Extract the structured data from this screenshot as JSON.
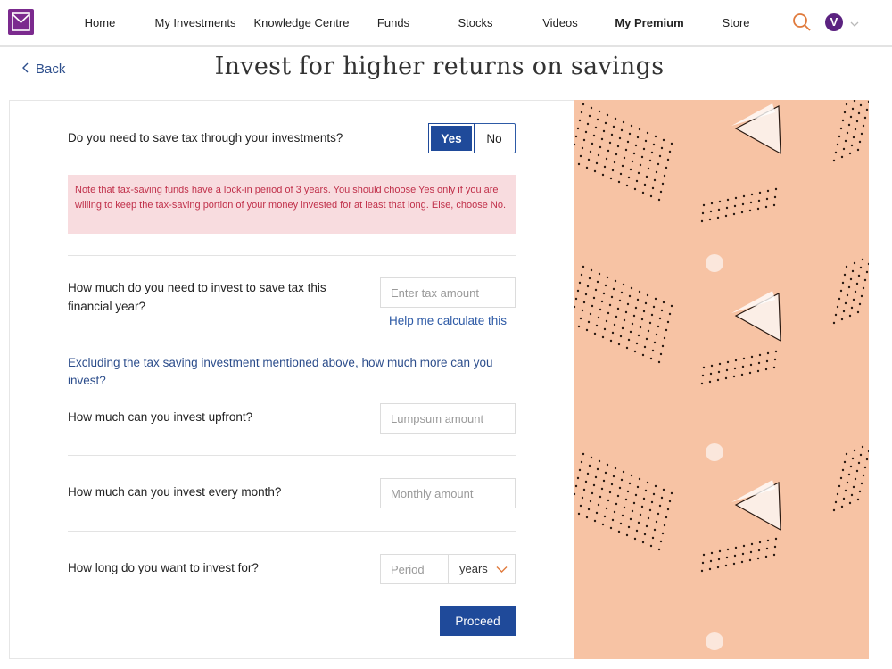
{
  "nav": {
    "items": [
      {
        "label": "Home",
        "bold": false
      },
      {
        "label": "My Investments",
        "bold": false
      },
      {
        "label": "Knowledge Centre",
        "bold": false
      },
      {
        "label": "Funds",
        "bold": false
      },
      {
        "label": "Stocks",
        "bold": false
      },
      {
        "label": "Videos",
        "bold": false
      },
      {
        "label": "My Premium",
        "bold": true
      },
      {
        "label": "Store",
        "bold": false
      }
    ],
    "avatar_letter": "V",
    "brand_color": "#7b2a8e",
    "search_icon_color": "#e07a3c"
  },
  "header": {
    "back_label": "Back",
    "title": "Invest for higher returns on savings"
  },
  "form": {
    "tax_question": "Do you need to save tax through your investments?",
    "toggle": {
      "yes_label": "Yes",
      "no_label": "No",
      "selected": "Yes"
    },
    "note": "Note that tax-saving funds have a lock-in period of 3 years. You should choose Yes only if you are willing to keep the tax-saving portion of your money invested for at least that long. Else, choose No.",
    "tax_amount_question": "How much do you need to invest to save tax this financial year?",
    "tax_amount_placeholder": "Enter tax amount",
    "help_link": "Help me calculate this",
    "excluding_text": "Excluding the tax saving investment mentioned above, how much more can you invest?",
    "upfront_question": "How much can you invest upfront?",
    "upfront_placeholder": "Lumpsum amount",
    "monthly_question": "How much can you invest every month?",
    "monthly_placeholder": "Monthly amount",
    "period_question": "How long do you want to invest for?",
    "period_placeholder": "Period",
    "period_unit": "years",
    "proceed_label": "Proceed"
  },
  "colors": {
    "primary": "#1f4a9a",
    "link": "#2d5aa6",
    "note_bg": "#f8dcdf",
    "note_text": "#c0304a",
    "art_bg": "#f7c3a4"
  }
}
